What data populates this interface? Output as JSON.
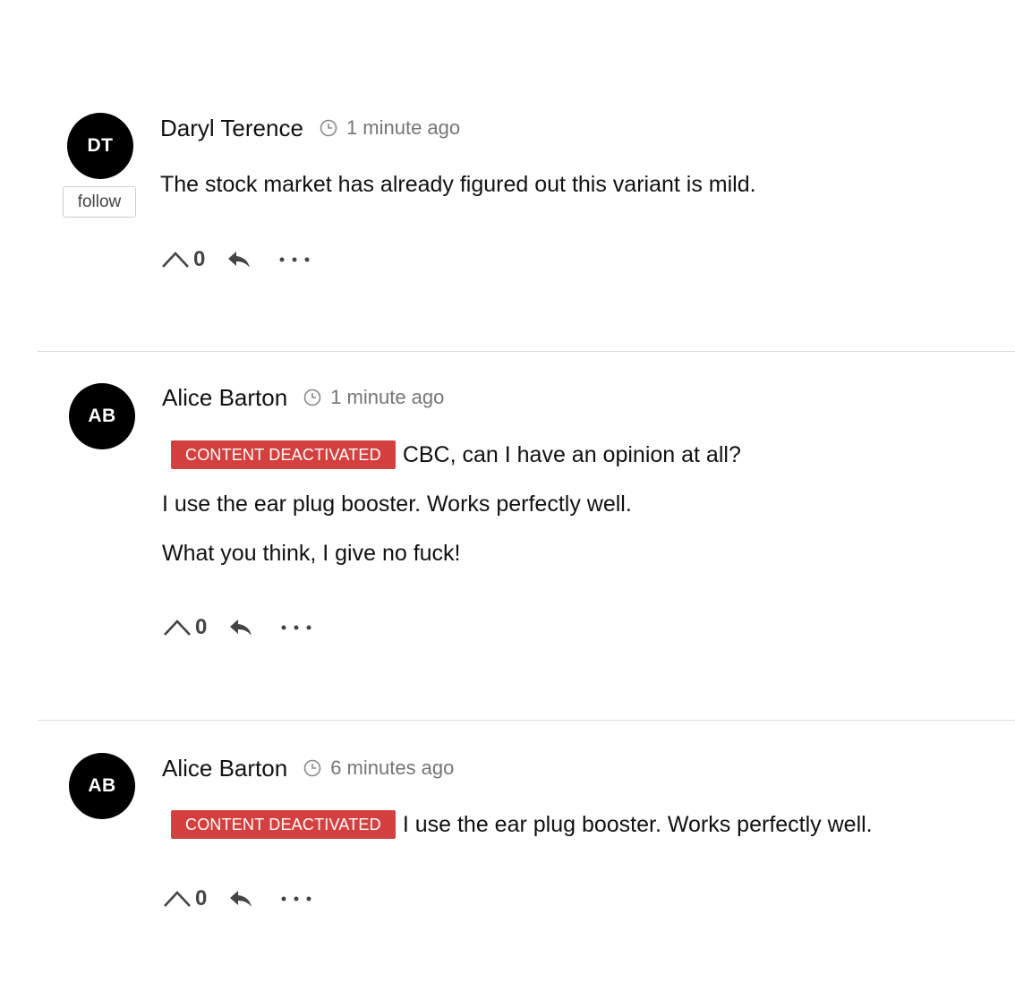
{
  "comments": [
    {
      "initials": "DT",
      "author": "Daryl Terence",
      "time": "1 minute ago",
      "follow_label": "follow",
      "lines": [
        {
          "badge": "",
          "text": "The stock market has already figured out this variant is mild."
        }
      ],
      "votes": "0"
    },
    {
      "initials": "AB",
      "author": "Alice Barton",
      "time": "1 minute ago",
      "lines": [
        {
          "badge": "CONTENT DEACTIVATED",
          "text": "CBC, can I have an opinion at all?"
        },
        {
          "badge": "",
          "text": "I use the ear plug booster. Works perfectly well."
        },
        {
          "badge": "",
          "text": "What you think, I give no fuck!"
        }
      ],
      "votes": "0"
    },
    {
      "initials": "AB",
      "author": "Alice Barton",
      "time": "6 minutes ago",
      "lines": [
        {
          "badge": "CONTENT DEACTIVATED",
          "text": "I use the ear plug booster. Works perfectly well."
        }
      ],
      "votes": "0"
    }
  ],
  "icons": {
    "time": "clock-icon",
    "upvote": "chevron-up-icon",
    "reply": "reply-icon",
    "more": "more-horizontal-icon"
  },
  "colors": {
    "badge": "#d3403f",
    "avatar": "#000000",
    "muted_text": "#757575",
    "divider": "#dcdcdc"
  }
}
